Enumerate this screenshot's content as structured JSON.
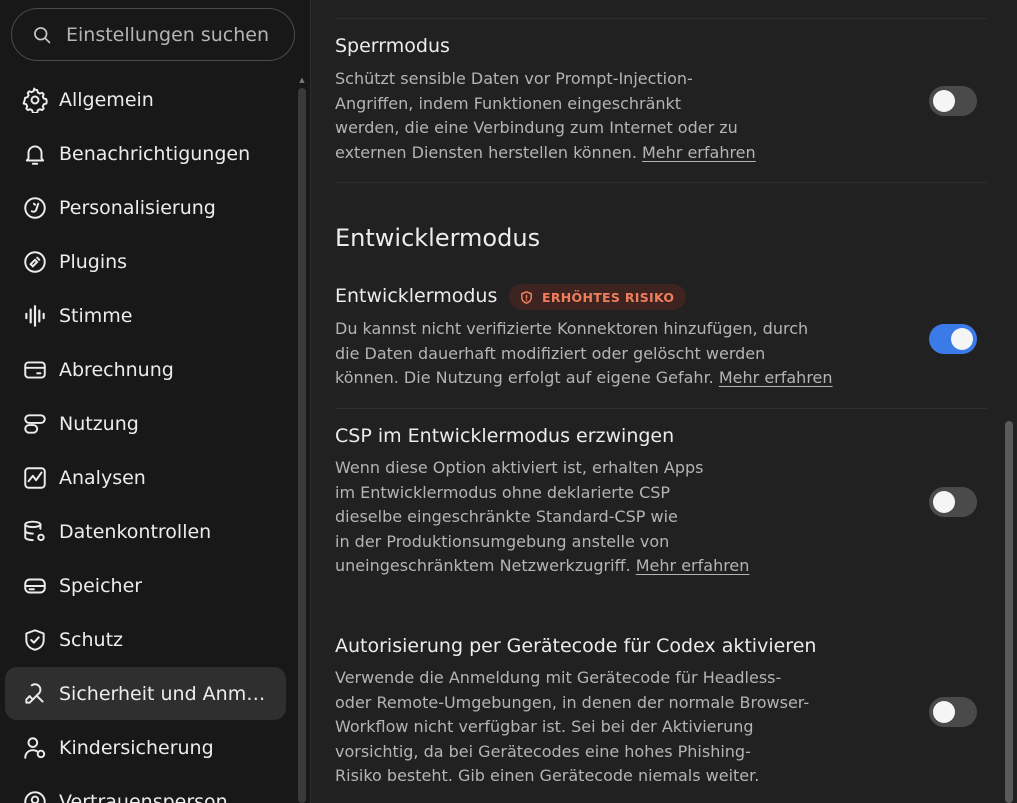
{
  "search": {
    "placeholder": "Einstellungen suchen"
  },
  "sidebar": {
    "items": [
      {
        "label": "Allgemein",
        "icon": "gear-icon"
      },
      {
        "label": "Benachrichtigungen",
        "icon": "bell-icon"
      },
      {
        "label": "Personalisierung",
        "icon": "personalization-icon"
      },
      {
        "label": "Plugins",
        "icon": "plugins-icon"
      },
      {
        "label": "Stimme",
        "icon": "voice-waveform-icon"
      },
      {
        "label": "Abrechnung",
        "icon": "credit-card-icon"
      },
      {
        "label": "Nutzung",
        "icon": "usage-icon"
      },
      {
        "label": "Analysen",
        "icon": "chart-icon"
      },
      {
        "label": "Datenkontrollen",
        "icon": "database-gear-icon"
      },
      {
        "label": "Speicher",
        "icon": "storage-icon"
      },
      {
        "label": "Schutz",
        "icon": "shield-check-icon"
      },
      {
        "label": "Sicherheit und Anm…",
        "icon": "security-icon",
        "active": true
      },
      {
        "label": "Kindersicherung",
        "icon": "parental-controls-icon"
      },
      {
        "label": "Vertrauensperson",
        "icon": "trusted-contact-icon"
      }
    ]
  },
  "main": {
    "lockdown": {
      "title": "Sperrmodus",
      "desc_lines": [
        "Schützt sensible Daten vor Prompt-Injection-",
        "Angriffen, indem Funktionen eingeschränkt",
        "werden, die eine Verbindung zum Internet oder zu",
        "externen Diensten herstellen können."
      ],
      "link": "Mehr erfahren",
      "enabled": false
    },
    "section_heading": "Entwicklermodus",
    "devmode": {
      "title": "Entwicklermodus",
      "badge": "ERHÖHTES RISIKO",
      "desc_lines": [
        "Du kannst nicht verifizierte Konnektoren hinzufügen, durch",
        "die Daten dauerhaft modifiziert oder gelöscht werden",
        "können. Die Nutzung erfolgt auf eigene Gefahr."
      ],
      "link": "Mehr erfahren",
      "enabled": true
    },
    "csp": {
      "title": "CSP im Entwicklermodus erzwingen",
      "desc_lines": [
        "Wenn diese Option aktiviert ist, erhalten Apps",
        "im Entwicklermodus ohne deklarierte CSP",
        "dieselbe eingeschränkte Standard-CSP wie",
        "in der Produktionsumgebung anstelle von",
        "uneingeschränktem Netzwerkzugriff."
      ],
      "link": "Mehr erfahren",
      "enabled": false
    },
    "device_code": {
      "title": "Autorisierung per Gerätecode für Codex aktivieren",
      "desc_lines": [
        "Verwende die Anmeldung mit Gerätecode für Headless-",
        "oder Remote-Umgebungen, in denen der normale Browser-",
        "Workflow nicht verfügbar ist. Sei bei der Aktivierung",
        "vorsichtig, da bei Gerätecodes eine hohes Phishing-",
        "Risiko besteht. Gib einen Gerätecode niemals weiter."
      ],
      "enabled": false
    }
  },
  "colors": {
    "accent": "#3a7be8",
    "risk": "#f07e5d",
    "risk_bg": "#3d2420"
  }
}
